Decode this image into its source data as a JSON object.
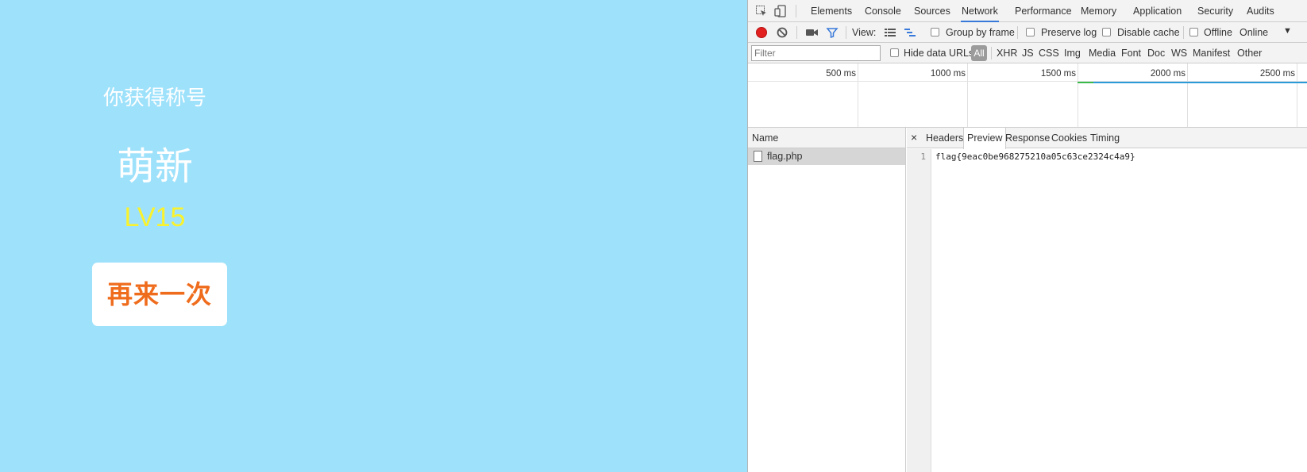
{
  "game": {
    "subtitle": "你获得称号",
    "title": "萌新",
    "level": "LV15",
    "retry_label": "再来一次"
  },
  "devtools": {
    "tabs": [
      "Elements",
      "Console",
      "Sources",
      "Network",
      "Performance",
      "Memory",
      "Application",
      "Security",
      "Audits"
    ],
    "active_tab": "Network",
    "toolbar": {
      "view_label": "View:",
      "group_by_frame": "Group by frame",
      "preserve_log": "Preserve log",
      "disable_cache": "Disable cache",
      "offline": "Offline",
      "throttle": "Online"
    },
    "filter": {
      "placeholder": "Filter",
      "hide_data_urls": "Hide data URLs",
      "types": [
        "All",
        "XHR",
        "JS",
        "CSS",
        "Img",
        "Media",
        "Font",
        "Doc",
        "WS",
        "Manifest",
        "Other"
      ]
    },
    "timeline_ticks": [
      "500 ms",
      "1000 ms",
      "1500 ms",
      "2000 ms",
      "2500 ms"
    ],
    "requests": {
      "column_name": "Name",
      "items": [
        "flag.php"
      ]
    },
    "detail": {
      "close": "×",
      "tabs": [
        "Headers",
        "Preview",
        "Response",
        "Cookies",
        "Timing"
      ],
      "active_tab": "Preview",
      "line_number": "1",
      "content": "flag{9eac0be968275210a05c63ce2324c4a9}"
    },
    "colors": {
      "accent": "#3879d9",
      "record": "#e32020"
    }
  }
}
